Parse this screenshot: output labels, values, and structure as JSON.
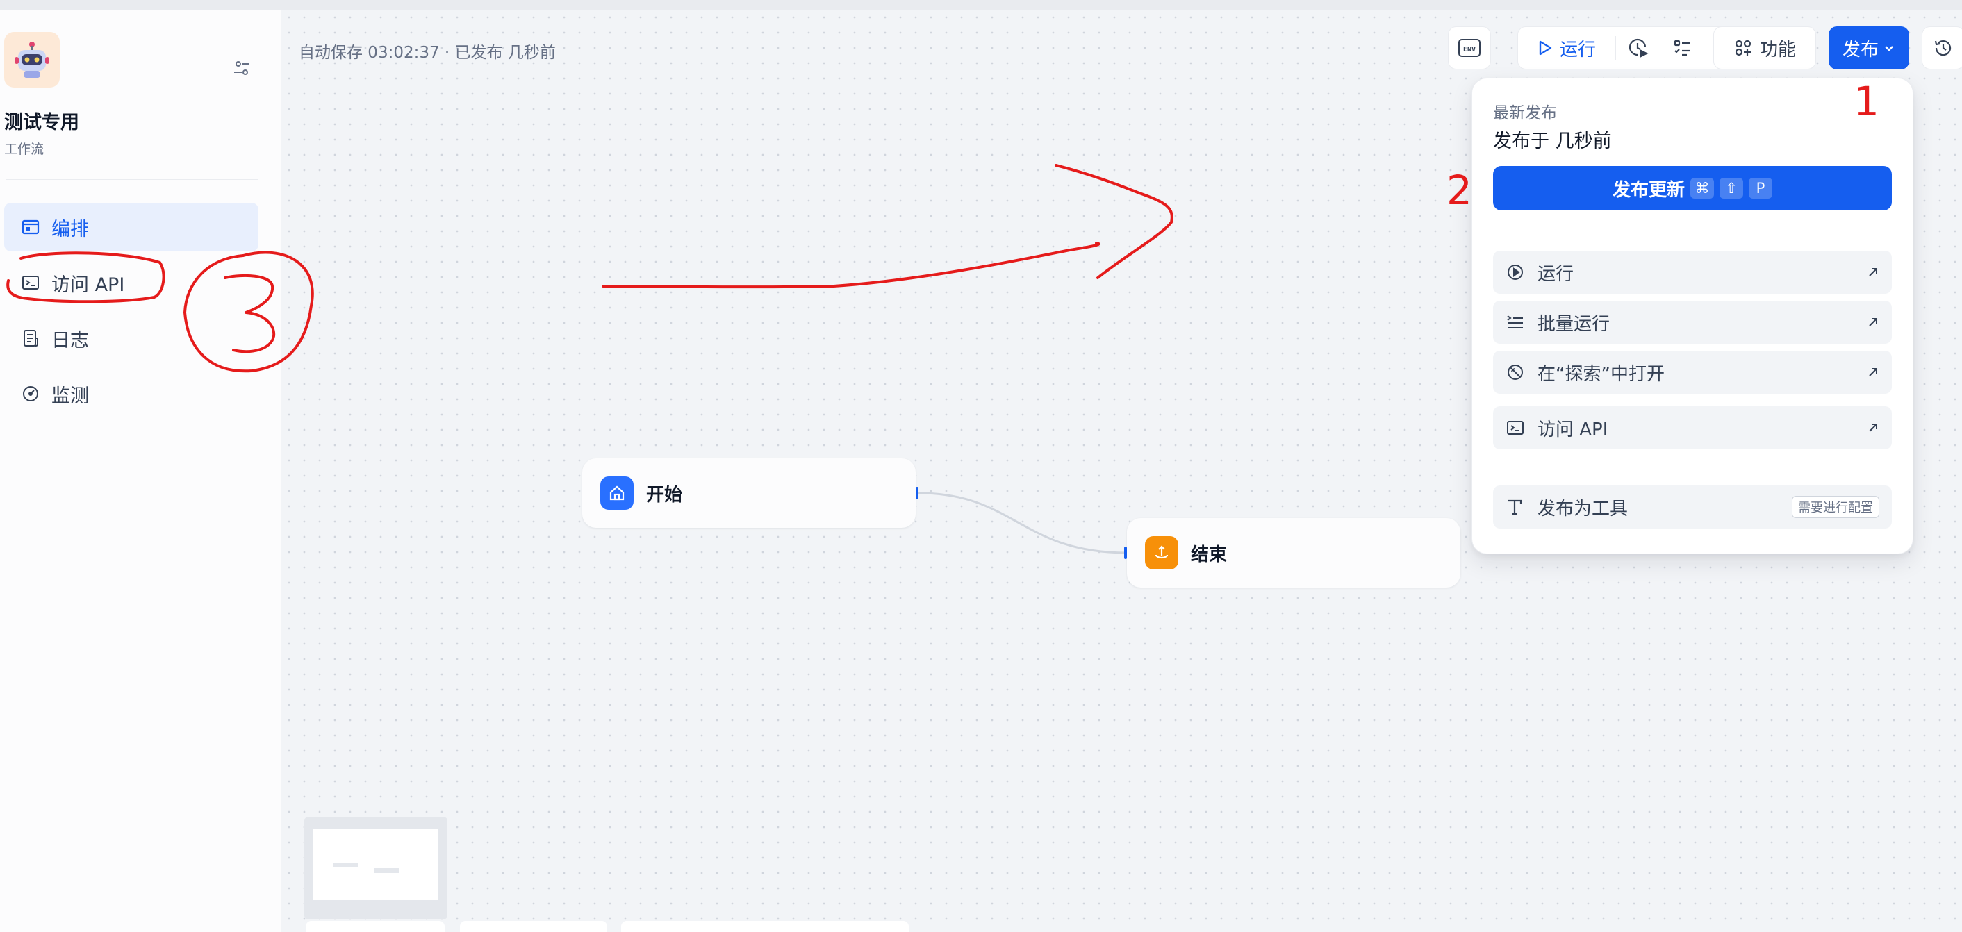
{
  "app": {
    "name": "测试专用",
    "type": "工作流"
  },
  "sidebar": {
    "items": [
      {
        "label": "编排",
        "icon": "layout-icon",
        "active": true
      },
      {
        "label": "访问 API",
        "icon": "terminal-icon",
        "active": false
      },
      {
        "label": "日志",
        "icon": "file-list-icon",
        "active": false
      },
      {
        "label": "监测",
        "icon": "gauge-icon",
        "active": false
      }
    ]
  },
  "status": {
    "text": "自动保存 03:02:37 · 已发布 几秒前"
  },
  "toolbar": {
    "env_label": "ENV",
    "run_label": "运行",
    "features_label": "功能",
    "publish_label": "发布"
  },
  "publish_menu": {
    "caption": "最新发布",
    "published_time": "发布于 几秒前",
    "publish_update_label": "发布更新",
    "shortcut": [
      "⌘",
      "⇧",
      "P"
    ],
    "items": [
      {
        "label": "运行",
        "icon": "play-circle-icon"
      },
      {
        "label": "批量运行",
        "icon": "batch-run-icon"
      },
      {
        "label": "在“探索”中打开",
        "icon": "explore-icon"
      },
      {
        "label": "访问 API",
        "icon": "terminal-icon"
      }
    ],
    "tool_item": {
      "label": "发布为工具",
      "badge": "需要进行配置",
      "icon": "tool-icon"
    }
  },
  "workflow": {
    "nodes": [
      {
        "label": "开始",
        "icon": "home-icon",
        "color": "#2970ff"
      },
      {
        "label": "结束",
        "icon": "end-icon",
        "color": "#f79009"
      }
    ]
  },
  "annotations": {
    "numbers": [
      "1",
      "2"
    ],
    "color": "#e51b1b"
  },
  "colors": {
    "accent": "#155eef",
    "active_bg": "#e8effd"
  }
}
